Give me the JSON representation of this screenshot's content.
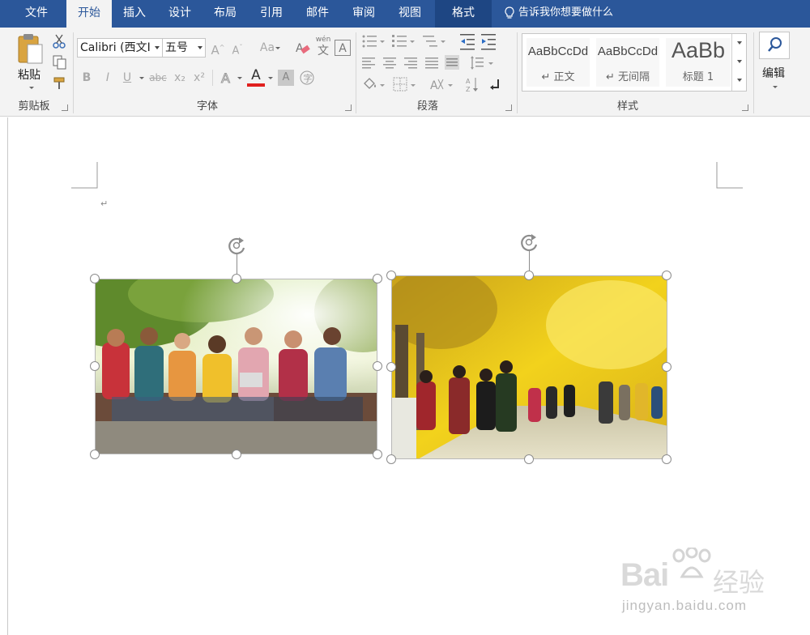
{
  "tabs": [
    {
      "label": "文件",
      "state": "normal"
    },
    {
      "label": "开始",
      "state": "active"
    },
    {
      "label": "插入",
      "state": "normal"
    },
    {
      "label": "设计",
      "state": "normal"
    },
    {
      "label": "布局",
      "state": "normal"
    },
    {
      "label": "引用",
      "state": "normal"
    },
    {
      "label": "邮件",
      "state": "normal"
    },
    {
      "label": "审阅",
      "state": "normal"
    },
    {
      "label": "视图",
      "state": "normal"
    },
    {
      "label": "格式",
      "state": "context"
    }
  ],
  "tell_me": "告诉我你想要做什么",
  "ribbon": {
    "clipboard": {
      "label": "剪贴板",
      "paste": "粘贴"
    },
    "font": {
      "label": "字体",
      "font_name": "Calibri (西文I",
      "font_size": "五号",
      "change_case": "Aa",
      "phonetic": "wén",
      "phonetic_char": "文",
      "bold": "B",
      "italic": "I",
      "underline": "U",
      "strike": "abc",
      "subscript": "x₂",
      "superscript": "x²",
      "font_color": "A",
      "font_color_swatch": "#e0201e",
      "char_border": "A"
    },
    "paragraph": {
      "label": "段落"
    },
    "styles": {
      "label": "样式",
      "items": [
        {
          "sample": "AaBbCcDd",
          "name": "↵ 正文"
        },
        {
          "sample": "AaBbCcDd",
          "name": "↵ 无间隔"
        },
        {
          "sample": "AaBb",
          "name": "标题 1"
        }
      ]
    },
    "editing": {
      "label": "编辑"
    }
  },
  "document": {
    "paragraph_mark": "↵",
    "images": [
      {
        "description": "group of friends sitting on a bench",
        "selected": true
      },
      {
        "description": "people walking under yellow ginkgo trees",
        "selected": true
      }
    ]
  },
  "watermark": {
    "brand": "Bai",
    "cn": "经验",
    "url": "jingyan.baidu.com"
  },
  "colors": {
    "tabbar": "#2b579a",
    "ribbon": "#f3f3f3",
    "active_tab_text": "#2b579a"
  }
}
